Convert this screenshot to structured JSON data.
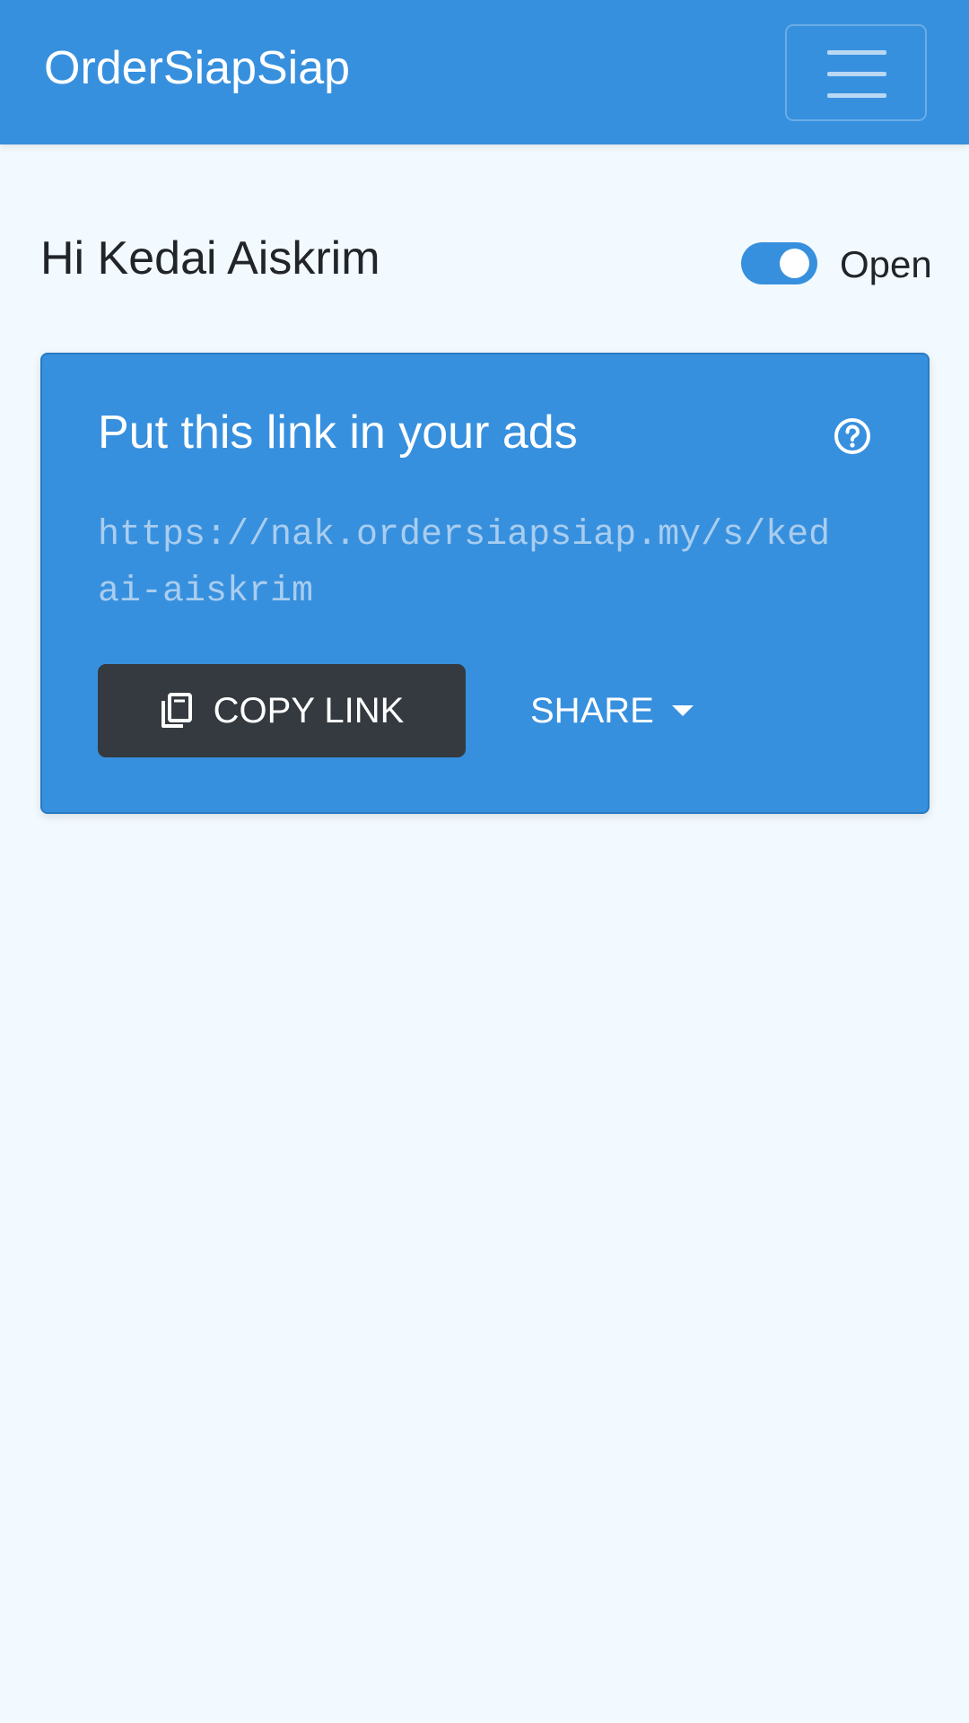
{
  "navbar": {
    "brand": "OrderSiapSiap",
    "menu_icon": "hamburger-menu-icon"
  },
  "greeting": "Hi Kedai Aiskrim",
  "store_status": {
    "label": "Open",
    "checked": true
  },
  "link_card": {
    "title": "Put this link in your ads",
    "help_icon": "question-circle-icon",
    "url": "https://nak.ordersiapsiap.my/s/kedai-aiskrim",
    "copy_label": "COPY LINK",
    "copy_icon": "copy-icon",
    "share_label": "SHARE",
    "share_icon": "caret-down-icon"
  },
  "colors": {
    "primary": "#3790de",
    "dark_button": "#343a40",
    "background": "#f3faff"
  }
}
